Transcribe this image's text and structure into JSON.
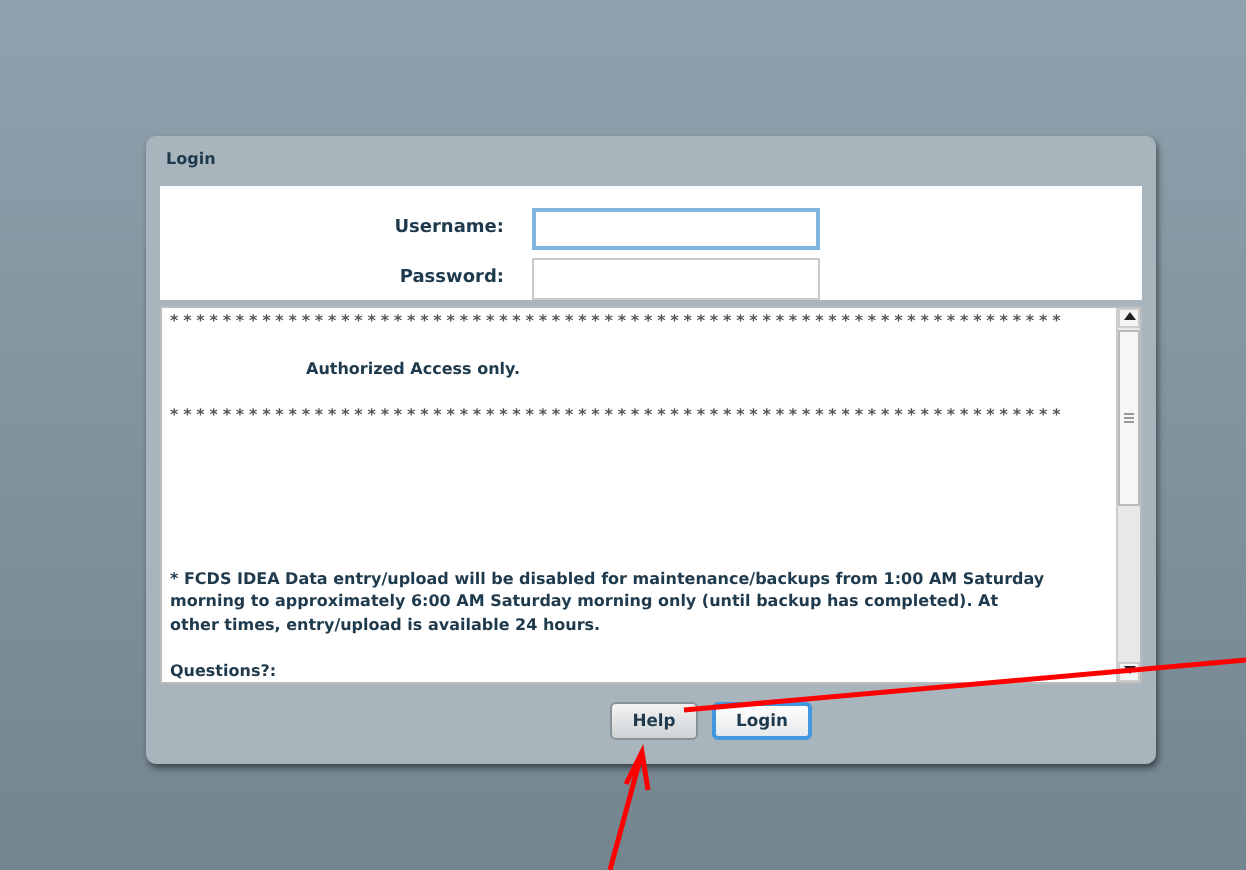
{
  "panel": {
    "title": "Login"
  },
  "fields": [
    {
      "label": "Username:",
      "focused": true
    },
    {
      "label": "Password:",
      "focused": false
    }
  ],
  "message": [
    {
      "kind": "rule",
      "text": "********************************************************************"
    },
    {
      "kind": "heading",
      "text": "Authorized Access only."
    },
    {
      "kind": "rule",
      "text": "********************************************************************"
    },
    {
      "kind": "gap"
    },
    {
      "kind": "para",
      "text": "* FCDS IDEA Data entry/upload will be disabled for maintenance/backups from 1:00 AM Saturday morning to approximately 6:00 AM Saturday morning only (until backup has completed). At other times, entry/upload is available 24 hours."
    },
    {
      "kind": "para",
      "text": "Questions?:"
    }
  ],
  "buttons": [
    {
      "label": "Help",
      "primary": false
    },
    {
      "label": "Login",
      "primary": true
    }
  ]
}
